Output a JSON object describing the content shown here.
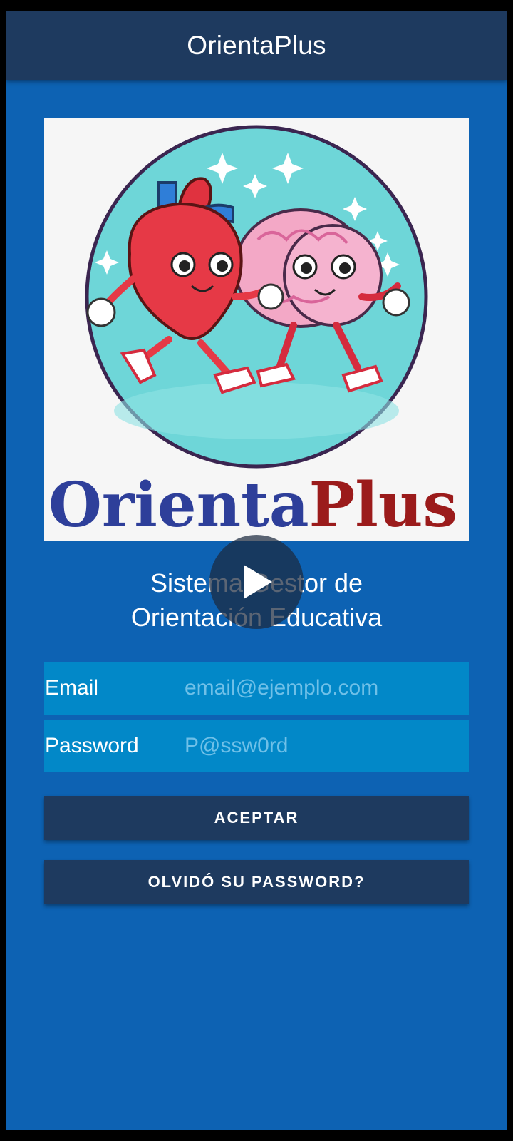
{
  "app_bar": {
    "title": "OrientaPlus"
  },
  "logo": {
    "wordmark_part1": "Orienta",
    "wordmark_part2": "Plus",
    "colors": {
      "part1": "#2e3f9a",
      "part2": "#9b1b1b",
      "circle": "#6ed6d8"
    }
  },
  "subtitle": {
    "line1": "Sistema Gestor de",
    "line2": "Orientación Educativa"
  },
  "video_overlay": {
    "icon": "play-icon"
  },
  "form": {
    "email": {
      "label": "Email",
      "placeholder": "email@ejemplo.com"
    },
    "password": {
      "label": "Password",
      "placeholder": "P@ssw0rd"
    },
    "accept_label": "ACEPTAR",
    "forgot_label": "OLVIDÓ SU PASSWORD?"
  },
  "colors": {
    "background": "#0d62b3",
    "app_bar": "#1e3a5f",
    "field": "#0288c8",
    "button": "#1e3a5f"
  }
}
